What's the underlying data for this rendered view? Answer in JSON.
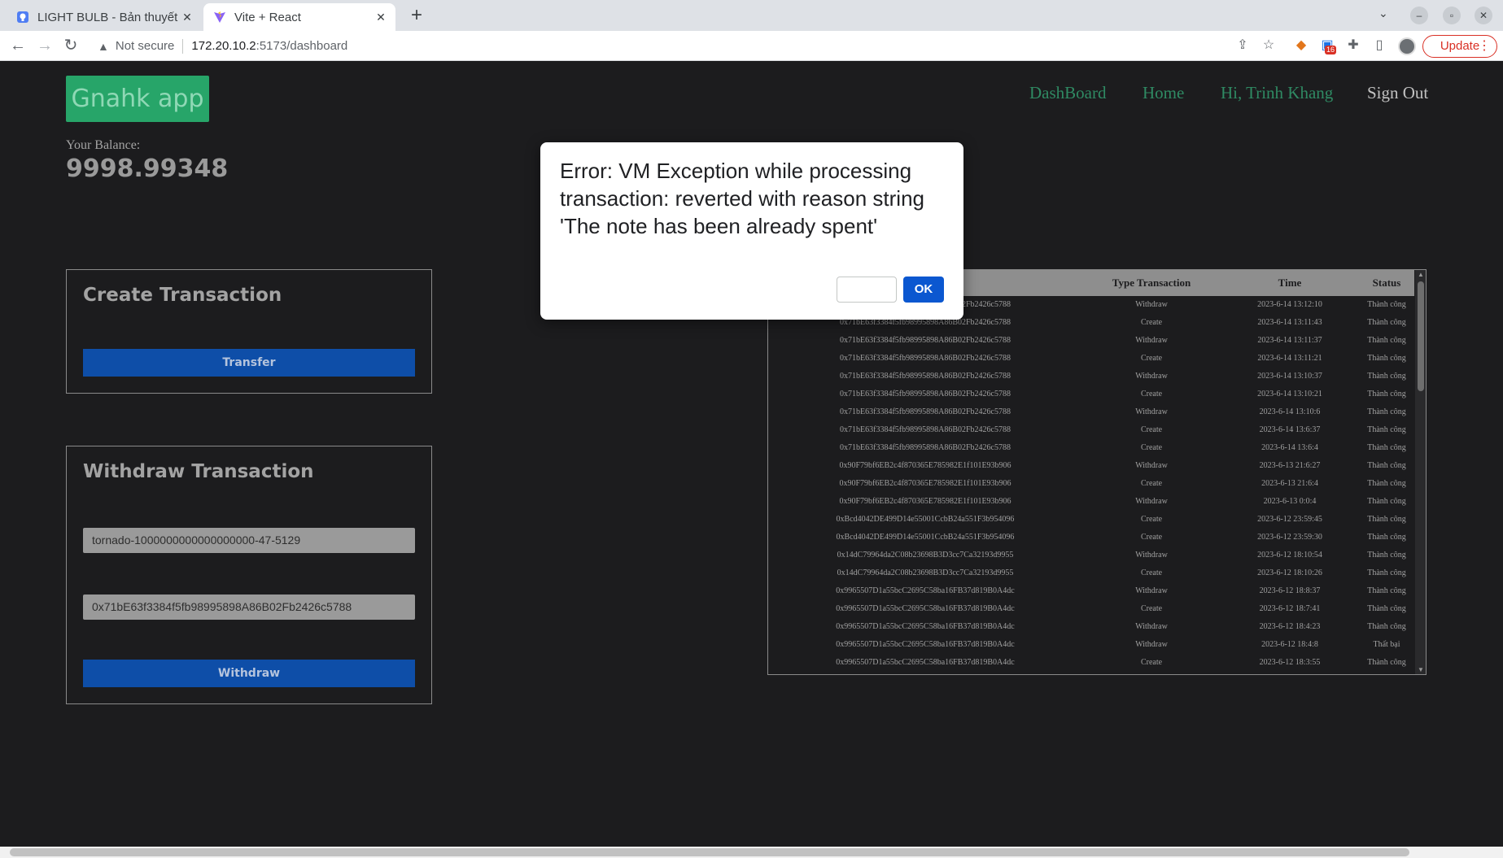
{
  "browser": {
    "tabs": [
      {
        "title": "LIGHT BULB - Bản thuyết"
      },
      {
        "title": "Vite + React"
      }
    ],
    "url_warning": "Not secure",
    "url_host": "172.20.10.2",
    "url_rest": ":5173/dashboard",
    "extension_badge": "16",
    "update_label": "Update"
  },
  "header": {
    "logo": "Gnahk app",
    "nav": [
      "DashBoard",
      "Home",
      "Hi, Trinh Khang",
      "Sign Out"
    ]
  },
  "balance": {
    "label": "Your Balance:",
    "value": "9998.99348"
  },
  "create_card": {
    "title": "Create Transaction",
    "button": "Transfer"
  },
  "withdraw_card": {
    "title": "Withdraw Transaction",
    "note_value": "tornado-1000000000000000000-47-5129",
    "address_value": "0x71bE63f3384f5fb98995898A86B02Fb2426c5788",
    "button": "Withdraw"
  },
  "table": {
    "headers": [
      "",
      "Type Transaction",
      "Time",
      "Status"
    ],
    "rows": [
      {
        "addr": "0x71bE63f3384f5fb98995898A86B02Fb2426c5788",
        "type": "Withdraw",
        "time": "2023-6-14 13:12:10",
        "status": "Thành công"
      },
      {
        "addr": "0x71bE63f3384f5fb98995898A86B02Fb2426c5788",
        "type": "Create",
        "time": "2023-6-14 13:11:43",
        "status": "Thành công"
      },
      {
        "addr": "0x71bE63f3384f5fb98995898A86B02Fb2426c5788",
        "type": "Withdraw",
        "time": "2023-6-14 13:11:37",
        "status": "Thành công"
      },
      {
        "addr": "0x71bE63f3384f5fb98995898A86B02Fb2426c5788",
        "type": "Create",
        "time": "2023-6-14 13:11:21",
        "status": "Thành công"
      },
      {
        "addr": "0x71bE63f3384f5fb98995898A86B02Fb2426c5788",
        "type": "Withdraw",
        "time": "2023-6-14 13:10:37",
        "status": "Thành công"
      },
      {
        "addr": "0x71bE63f3384f5fb98995898A86B02Fb2426c5788",
        "type": "Create",
        "time": "2023-6-14 13:10:21",
        "status": "Thành công"
      },
      {
        "addr": "0x71bE63f3384f5fb98995898A86B02Fb2426c5788",
        "type": "Withdraw",
        "time": "2023-6-14 13:10:6",
        "status": "Thành công"
      },
      {
        "addr": "0x71bE63f3384f5fb98995898A86B02Fb2426c5788",
        "type": "Create",
        "time": "2023-6-14 13:6:37",
        "status": "Thành công"
      },
      {
        "addr": "0x71bE63f3384f5fb98995898A86B02Fb2426c5788",
        "type": "Create",
        "time": "2023-6-14 13:6:4",
        "status": "Thành công"
      },
      {
        "addr": "0x90F79bf6EB2c4f870365E785982E1f101E93b906",
        "type": "Withdraw",
        "time": "2023-6-13 21:6:27",
        "status": "Thành công"
      },
      {
        "addr": "0x90F79bf6EB2c4f870365E785982E1f101E93b906",
        "type": "Create",
        "time": "2023-6-13 21:6:4",
        "status": "Thành công"
      },
      {
        "addr": "0x90F79bf6EB2c4f870365E785982E1f101E93b906",
        "type": "Withdraw",
        "time": "2023-6-13 0:0:4",
        "status": "Thành công"
      },
      {
        "addr": "0xBcd4042DE499D14e55001CcbB24a551F3b954096",
        "type": "Create",
        "time": "2023-6-12 23:59:45",
        "status": "Thành công"
      },
      {
        "addr": "0xBcd4042DE499D14e55001CcbB24a551F3b954096",
        "type": "Create",
        "time": "2023-6-12 23:59:30",
        "status": "Thành công"
      },
      {
        "addr": "0x14dC79964da2C08b23698B3D3cc7Ca32193d9955",
        "type": "Withdraw",
        "time": "2023-6-12 18:10:54",
        "status": "Thành công"
      },
      {
        "addr": "0x14dC79964da2C08b23698B3D3cc7Ca32193d9955",
        "type": "Create",
        "time": "2023-6-12 18:10:26",
        "status": "Thành công"
      },
      {
        "addr": "0x9965507D1a55bcC2695C58ba16FB37d819B0A4dc",
        "type": "Withdraw",
        "time": "2023-6-12 18:8:37",
        "status": "Thành công"
      },
      {
        "addr": "0x9965507D1a55bcC2695C58ba16FB37d819B0A4dc",
        "type": "Create",
        "time": "2023-6-12 18:7:41",
        "status": "Thành công"
      },
      {
        "addr": "0x9965507D1a55bcC2695C58ba16FB37d819B0A4dc",
        "type": "Withdraw",
        "time": "2023-6-12 18:4:23",
        "status": "Thành công"
      },
      {
        "addr": "0x9965507D1a55bcC2695C58ba16FB37d819B0A4dc",
        "type": "Withdraw",
        "time": "2023-6-12 18:4:8",
        "status": "Thất bại"
      },
      {
        "addr": "0x9965507D1a55bcC2695C58ba16FB37d819B0A4dc",
        "type": "Create",
        "time": "2023-6-12 18:3:55",
        "status": "Thành công"
      }
    ]
  },
  "dialog": {
    "message": "Error: VM Exception while processing transaction: reverted with reason string 'The note has been already spent'",
    "ok_label": "OK"
  },
  "colors": {
    "page_bg": "#1c1c1e",
    "logo_bg": "#27a569",
    "nav_link": "#2f8a63",
    "button_bg": "#0e4ea8",
    "dialog_ok": "#0b57d0"
  },
  "icons": {
    "tab1_favicon": "light-bulb-favicon",
    "tab2_favicon": "vite-favicon",
    "back": "back-arrow-icon",
    "forward": "forward-arrow-icon",
    "reload": "reload-icon",
    "warning": "warning-triangle-icon",
    "share": "share-icon",
    "star": "star-icon",
    "metamask": "fox-icon",
    "extensions": "puzzle-icon",
    "sidepanel": "side-panel-icon"
  }
}
